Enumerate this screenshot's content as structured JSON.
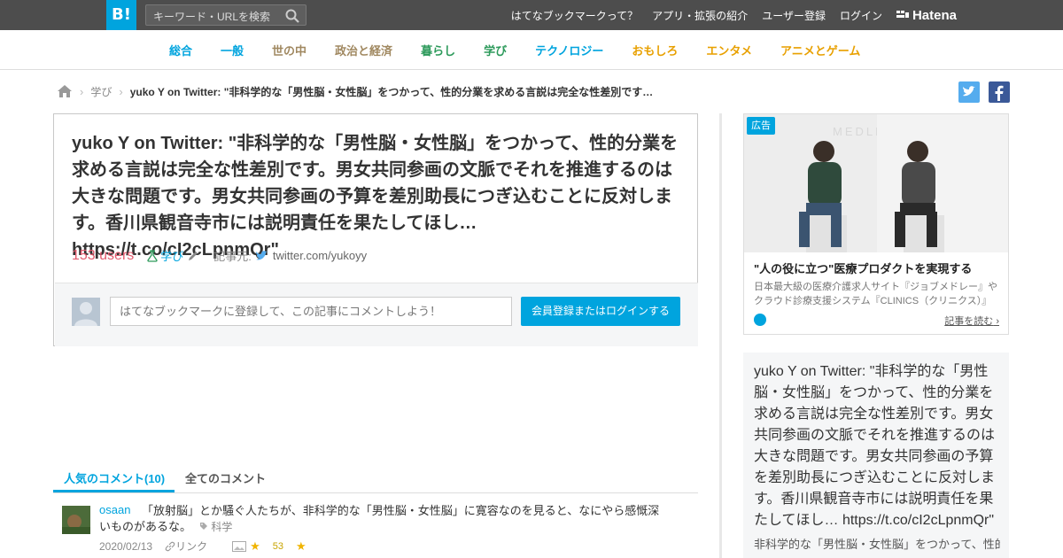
{
  "header": {
    "logo": "B!",
    "search_placeholder": "キーワード・URLを検索",
    "links": [
      "はてなブックマークって？",
      "アプリ・拡張の紹介",
      "ユーザー登録",
      "ログイン"
    ],
    "brand": "Hatena"
  },
  "categories": [
    {
      "label": "総合",
      "color": "#00a4de"
    },
    {
      "label": "一般",
      "color": "#00a4de"
    },
    {
      "label": "世の中",
      "color": "#a08860"
    },
    {
      "label": "政治と経済",
      "color": "#a08860"
    },
    {
      "label": "暮らし",
      "color": "#2d9a5b"
    },
    {
      "label": "学び",
      "color": "#2d9a5b"
    },
    {
      "label": "テクノロジー",
      "color": "#00a4de"
    },
    {
      "label": "おもしろ",
      "color": "#e8a000"
    },
    {
      "label": "エンタメ",
      "color": "#e8a000"
    },
    {
      "label": "アニメとゲーム",
      "color": "#e8a000"
    }
  ],
  "breadcrumb": {
    "category": "学び",
    "current": "yuko Y on Twitter: \"非科学的な「男性脳・女性脳」をつかって、性的分業を求める言説は完全な性差別です…"
  },
  "entry": {
    "title": "yuko Y on Twitter: \"非科学的な「男性脳・女性脳」をつかって、性的分業を求める言説は完全な性差別です。男女共同参画の文脈でそれを推進するのは大きな問題です。男女共同参画の予算を差別助長につぎ込むことに反対します。香川県観音寺市には説明責任を果たしてほし… https://t.co/cI2cLpnmQr\"",
    "users": "153 users",
    "tag": "学び",
    "source_label": "記事元:",
    "source": "twitter.com/yukoyy",
    "comment_placeholder": "はてなブックマークに登録して、この記事にコメントしよう！",
    "login_button": "会員登録またはログインする"
  },
  "comment_tabs": {
    "popular": "人気のコメント(10)",
    "all": "全てのコメント"
  },
  "bookmarks": [
    {
      "user": "osaan",
      "comment": "「放射脳」とか騒ぐ人たちが、非科学的な「男性脳・女性脳」に寛容なのを見ると、なにやら感慨深いものがあるな。",
      "tag": "科学",
      "date": "2020/02/13",
      "link_label": "リンク",
      "stars": "53"
    }
  ],
  "ad": {
    "badge": "広告",
    "title": "\"人の役に立つ\"医療プロダクトを実現する",
    "desc": "日本最大級の医療介護求人サイト『ジョブメドレー』やクラウド診療支援システム『CLINICS（クリニクス）』",
    "read_more": "記事を読む",
    "watermark": "MEDLEY"
  },
  "summary": {
    "text": "yuko Y on Twitter: \"非科学的な「男性脳・女性脳」をつかって、性的分業を求める言説は完全な性差別です。男女共同参画の文脈でそれを推進するのは大きな問題です。男女共同参画の予算を差別助長につぎ込むことに反対します。香川県観音寺市には説明責任を果たしてほし… https://t.co/cI2cLpnmQr\"",
    "sub": "非科学的な「男性脳・女性脳」をつかって、性的分業を求める言説は"
  }
}
